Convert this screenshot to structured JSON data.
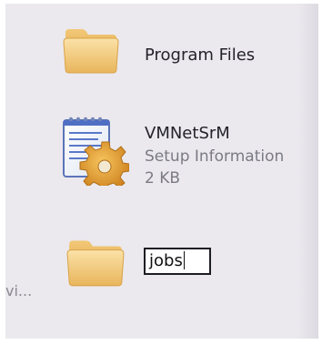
{
  "items": [
    {
      "icon": "folder-icon",
      "name": "Program Files"
    },
    {
      "icon": "setup-information-file-icon",
      "name": "VMNetSrM",
      "type": "Setup Information",
      "size": "2 KB"
    },
    {
      "icon": "folder-icon",
      "rename_value": "jobs"
    }
  ],
  "clipped_text": "vi..."
}
